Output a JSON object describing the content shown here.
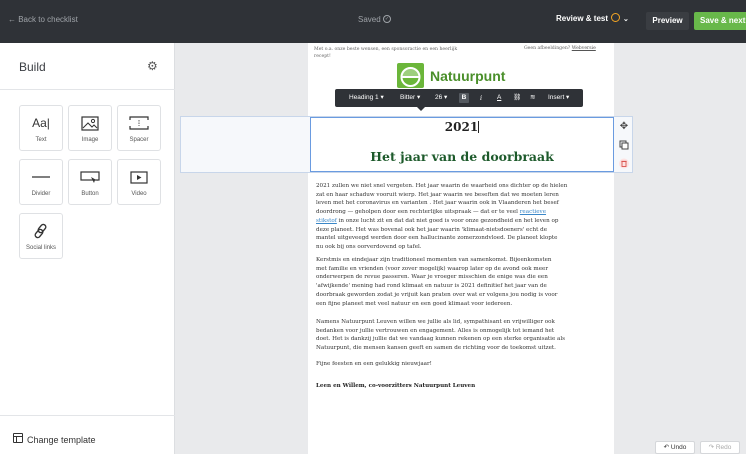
{
  "topbar": {
    "back_label": "← Back to checklist",
    "status": "Saved",
    "review_label": "Review & test",
    "preview_label": "Preview",
    "save_label": "Save & next",
    "accent_color": "#68b84a",
    "warning_color": "#f5a623"
  },
  "sidebar": {
    "title": "Build",
    "blocks": [
      {
        "label": "Text",
        "icon": "text-icon"
      },
      {
        "label": "Image",
        "icon": "image-icon"
      },
      {
        "label": "Spacer",
        "icon": "spacer-icon"
      },
      {
        "label": "Divider",
        "icon": "divider-icon"
      },
      {
        "label": "Button",
        "icon": "button-icon"
      },
      {
        "label": "Video",
        "icon": "video-icon"
      },
      {
        "label": "Social links",
        "icon": "link-icon"
      }
    ],
    "text_icon_glyph": "Aa|",
    "change_template_label": "Change template"
  },
  "toolbar": {
    "style": "Heading 1 ▾",
    "font": "Bitter ▾",
    "size": "26 ▾",
    "bold": "B",
    "italic": "i",
    "color": "A",
    "link": "⛓",
    "clear": "≋",
    "insert": "Insert ▾"
  },
  "email": {
    "preheader_left": "Met o.a. onze beste wensen, een sponsoractie en een heerlijk recept!",
    "preheader_right_text": "Geen afbeeldingen?",
    "preheader_right_link": "Webversie",
    "brand": "Natuurpunt",
    "heading_year": "2021",
    "heading_title": "Het jaar van de doorbraak",
    "p1": [
      "2021 zullen we niet snel vergeten. Het jaar waarin de waarheid ons dichter op de hielen",
      "zat en haar schaduw vooruit wierp. Het jaar waarin we beseften dat we moeten leren",
      "leven met het coronavirus en varianten . Het jaar waarin ook in Vlaanderen het besef",
      "doordrong — geholpen door een rechterlijke uitspraak — dat er te veel",
      "in onze lucht zit en dat dat niet goed is voor onze gezondheid en het leven op",
      "deze planeet. Het was bovenal ook het jaar waarin 'klimaat-nietsdoeners' echt de",
      "mantel uitgeveegd werden door een hallucinante zomerzondvloed. De planeet klopte",
      "nu ook bij ons oorverdovend op tafel."
    ],
    "p1_link_a": "reactieve",
    "p1_link_b": "stikstof",
    "p2": [
      "Kerstmis en eindejaar zijn traditioneel momenten van samenkomst. Bijeenkomsten",
      "met familie en vrienden (voor zover mogelijk) waarop later op de avond ook meer",
      "onderwerpen de revue passeren. Waar je vroeger misschien de enige was die een",
      "'afwijkende' mening had rond klimaat en natuur is 2021 definitief het jaar van de",
      "doorbraak geworden zodat je vrijuit kan praten over wat er volgens jou nodig is voor",
      "een fijne planeet met veel natuur en een goed klimaat voor iedereen."
    ],
    "p3": [
      "Namens Natuurpunt Leuven willen we jullie als lid, sympathisant en vrijwilliger ook",
      "bedanken voor jullie vertrouwen en engagement. Alles is onmogelijk tot iemand het",
      "doet. Het is dankzij jullie dat we vandaag kunnen rekenen op een sterke organisatie als",
      "Natuurpunt, die mensen kansen geeft en samen de richting voor de toekomst uitzet."
    ],
    "p4": "Fijne feesten en een gelukkig nieuwjaar!",
    "signature": "Leen en Willem, co-voorzitters Natuurpunt Leuven",
    "link_color": "#3a87c8",
    "title_color": "#1d5a2b"
  },
  "history": {
    "undo_label": "↶ Undo",
    "redo_label": "↷ Redo"
  }
}
